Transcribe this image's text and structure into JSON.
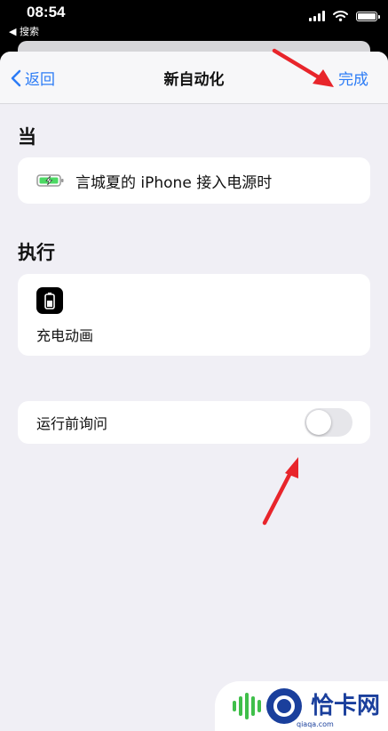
{
  "status_bar": {
    "time": "08:54",
    "back_app": "◀ 搜索"
  },
  "nav": {
    "back_label": "返回",
    "title": "新自动化",
    "done_label": "完成"
  },
  "when_section": {
    "header": "当",
    "trigger_text": "言城夏的 iPhone 接入电源时"
  },
  "do_section": {
    "header": "执行",
    "action_label": "充电动画"
  },
  "ask_before_running": {
    "label": "运行前询问",
    "enabled": false
  },
  "watermark": {
    "text": "恰卡网",
    "domain": "qiaqa.com"
  },
  "colors": {
    "accent": "#2c7cf6",
    "annotation_arrow": "#e8252b",
    "sheet_background": "#f0eff5"
  }
}
